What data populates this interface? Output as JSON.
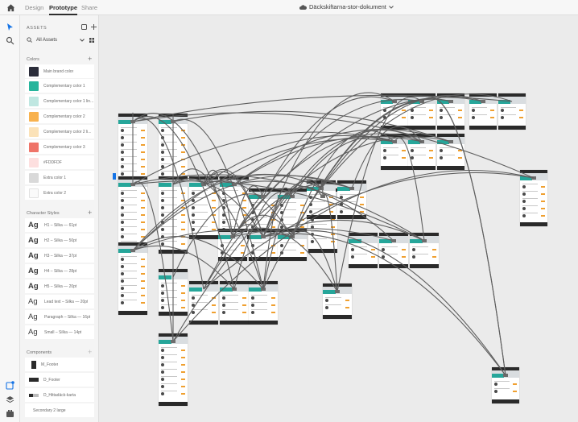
{
  "header": {
    "tabs": [
      {
        "label": "Design",
        "active": false
      },
      {
        "label": "Prototype",
        "active": true
      },
      {
        "label": "Share",
        "active": false
      }
    ],
    "document_title": "Däckskiftarna-stor-dokument"
  },
  "assets": {
    "title": "ASSETS",
    "filter_label": "All Assets",
    "colors": {
      "label": "Colors",
      "items": [
        {
          "label": "Main brand color",
          "color": "#2b2d3a"
        },
        {
          "label": "Complementary color 1",
          "color": "#26b59c"
        },
        {
          "label": "Complementary color 1 lin...",
          "color": "#bfe7e1"
        },
        {
          "label": "Complementary color 2",
          "color": "#f8b24e"
        },
        {
          "label": "Complementary color 2 li...",
          "color": "#fbe2b8"
        },
        {
          "label": "Complementary color 3",
          "color": "#ef7469"
        },
        {
          "label": "#FDDFDF",
          "color": "#fddfdf"
        },
        {
          "label": "Extra color 1",
          "color": "#d9d9d9"
        },
        {
          "label": "Extra color 2",
          "color": "#fafafa"
        }
      ]
    },
    "character_styles": {
      "label": "Character Styles",
      "items": [
        {
          "glyph": "Ag",
          "label": "H1 – Silka — 61pt"
        },
        {
          "glyph": "Ag",
          "label": "H2 – Silka — 50pt"
        },
        {
          "glyph": "Ag",
          "label": "H3 – Silka — 37pt"
        },
        {
          "glyph": "Ag",
          "label": "H4 – Silka — 28pt"
        },
        {
          "glyph": "Ag",
          "label": "H5 – Silka — 20pt"
        },
        {
          "glyph": "Ag",
          "label": "Lead text – Silka — 20pt"
        },
        {
          "glyph": "Ag",
          "label": "Paragraph – Silka — 16pt"
        },
        {
          "glyph": "Ag",
          "label": "Small – Silka — 14pt"
        }
      ]
    },
    "components": {
      "label": "Components",
      "items": [
        {
          "label": "M_Footer"
        },
        {
          "label": "D_Footer"
        },
        {
          "label": "D_Hittadäck-karta"
        },
        {
          "label": "Secondary 2 large"
        }
      ]
    }
  },
  "icons": {
    "home": "home-icon",
    "cloud": "cloud-icon",
    "select": "select-arrow-icon",
    "search": "search-icon",
    "assets": "assets-icon",
    "layers": "layers-icon",
    "plugins": "plugins-icon"
  },
  "colors": {
    "accent": "#26a69a",
    "wire": "#5e5e5e",
    "frame_dark": "#2a2a2a"
  }
}
